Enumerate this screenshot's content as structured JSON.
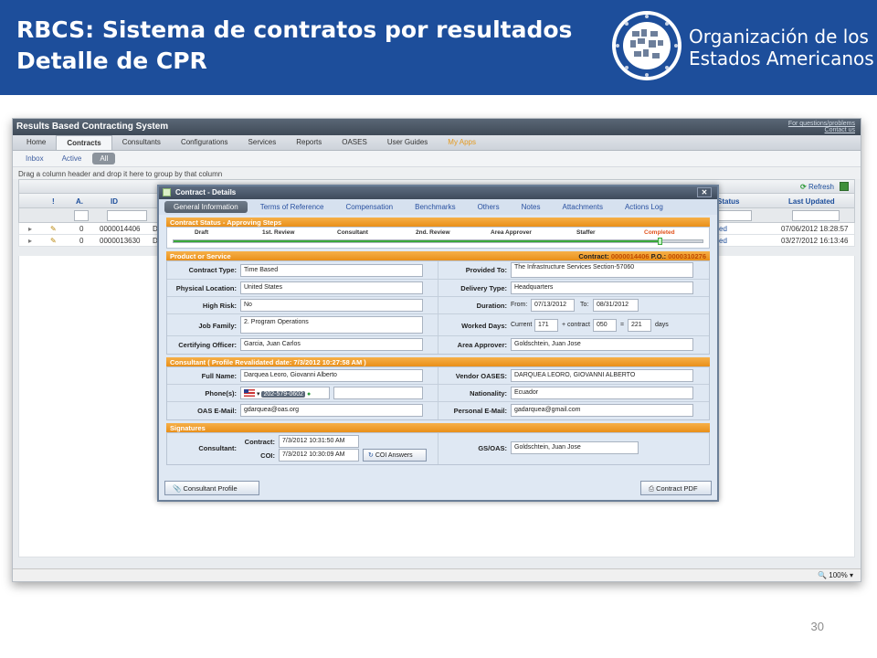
{
  "slide": {
    "title_line1": "RBCS: Sistema de contratos por resultados",
    "title_line2": "Detalle de CPR",
    "org_line1": "Organización de los",
    "org_line2": "Estados Americanos",
    "page_number": "30",
    "colors": {
      "header_bg": "#1d4e9b"
    }
  },
  "app": {
    "title": "Results Based Contracting System",
    "help_line1": "For questions/problems",
    "help_line2": "Contact us",
    "nav": [
      "Home",
      "Contracts",
      "Consultants",
      "Configurations",
      "Services",
      "Reports",
      "OASES",
      "User Guides",
      "My Apps"
    ],
    "active_nav": "Contracts",
    "subnav": [
      "Inbox",
      "Active",
      "All"
    ],
    "active_subnav": "All",
    "drag_hint": "Drag a column header and drop it here to group by that column",
    "refresh_label": "Refresh",
    "columns": {
      "c1": "!",
      "c2": "A.",
      "c3": "ID",
      "status": "Status",
      "last_updated": "Last Updated"
    },
    "rows": [
      {
        "count": "0",
        "id": "0000014406",
        "d": "D",
        "status": "ed",
        "updated": "07/06/2012 18:28:57"
      },
      {
        "count": "0",
        "id": "0000013630",
        "d": "D",
        "status": "ed",
        "updated": "03/27/2012 16:13:46"
      }
    ],
    "zoom": "100%"
  },
  "modal": {
    "title": "Contract - Details",
    "tabs": [
      "General Information",
      "Terms of Reference",
      "Compensation",
      "Benchmarks",
      "Others",
      "Notes",
      "Attachments",
      "Actions Log"
    ],
    "active_tab": "General Information",
    "status_section": "Contract Status - Approving Steps",
    "steps": [
      "Draft",
      "1st. Review",
      "Consultant",
      "2nd. Review",
      "Area Approver",
      "Staffer",
      "Completed"
    ],
    "step_progress": 0.92,
    "product_section": "Product or Service",
    "contract_label": "Contract:",
    "contract_number": "0000014406",
    "po_label": "P.O.:",
    "po_number": "0000310276",
    "fields": {
      "contract_type_label": "Contract Type:",
      "contract_type": "Time Based",
      "provided_to_label": "Provided To:",
      "provided_to": "The Infrastructure Services Section-57060",
      "physical_location_label": "Physical Location:",
      "physical_location": "United States",
      "delivery_type_label": "Delivery Type:",
      "delivery_type": "Headquarters",
      "high_risk_label": "High Risk:",
      "high_risk": "No",
      "duration_label": "Duration:",
      "from_label": "From:",
      "from_date": "07/13/2012",
      "to_label": "To:",
      "to_date": "08/31/2012",
      "job_family_label": "Job Family:",
      "job_family": "2. Program Operations",
      "worked_days_label": "Worked Days:",
      "current_label": "Current",
      "current_days": "171",
      "plus_contract_label": "+ contract",
      "contract_days": "050",
      "equals": "=",
      "total_days": "221",
      "days_label": "days",
      "certifying_officer_label": "Certifying Officer:",
      "certifying_officer": "Garcia, Juan Carlos",
      "area_approver_label": "Area Approver:",
      "area_approver": "Goldschtein, Juan Jose"
    },
    "consultant_section": "Consultant ( Profile Revalidated date: 7/3/2012 10:27:58 AM )",
    "consultant": {
      "full_name_label": "Full Name:",
      "full_name": "Darquea Leoro, Giovanni Alberto",
      "vendor_label": "Vendor OASES:",
      "vendor": "DARQUEA LEORO, GIOVANNI ALBERTO",
      "phone_label": "Phone(s):",
      "phone": "202-579-0602",
      "nationality_label": "Nationality:",
      "nationality": "Ecuador",
      "oas_email_label": "OAS E-Mail:",
      "oas_email": "gdarquea@oas.org",
      "personal_email_label": "Personal E-Mail:",
      "personal_email": "gadarquea@gmail.com"
    },
    "signatures_section": "Signatures",
    "signatures": {
      "consultant_label": "Consultant:",
      "contract_label": "Contract:",
      "contract_date": "7/3/2012 10:31:50 AM",
      "coi_label": "COI:",
      "coi_date": "7/3/2012 10:30:09 AM",
      "coi_button": "COI Answers",
      "gsoas_label": "GS/OAS:",
      "gsoas": "Goldschtein, Juan Jose"
    },
    "consultant_profile_button": "Consultant Profile",
    "contract_pdf_button": "Contract PDF"
  }
}
